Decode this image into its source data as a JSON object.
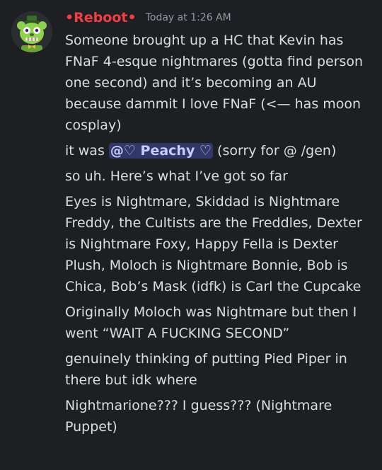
{
  "message": {
    "username": "•Reboot•",
    "timestamp": "Today at 1:26 AM",
    "lines": [
      "Someone brought up a HC that Kevin has FNaF 4-esque nightmares (gotta find person one second) and it’s becoming an AU because dammit I love FNaF (<— has moon cosplay)",
      "so uh. Here’s what I’ve got so far",
      "Eyes is Nightmare, Skiddad is Nightmare Freddy, the Cultists are the Freddles, Dexter is Nightmare Foxy, Happy Fella is Dexter Plush, Moloch is Nightmare Bonnie, Bob is Chica, Bob’s Mask (idfk) is Carl the Cupcake",
      "Originally Moloch was Nightmare but then I went “WAIT A FUCKING SECOND”",
      "genuinely thinking of putting Pied Piper in there but idk where",
      "Nightmarione??? I guess??? (Nightmare Puppet)"
    ],
    "mention_line": {
      "prefix": "it was ",
      "mention": "@♡ Peachy ♡",
      "suffix": " (sorry for @ /gen)"
    }
  },
  "colors": {
    "background": "#1e1f22",
    "username": "#f23f43",
    "text": "#dbdee1",
    "timestamp": "#949ba4",
    "mention_bg": "#5865f2",
    "avatar_green": "#8fd14f"
  },
  "icons": {
    "avatar": "green-animatronic-avatar"
  }
}
